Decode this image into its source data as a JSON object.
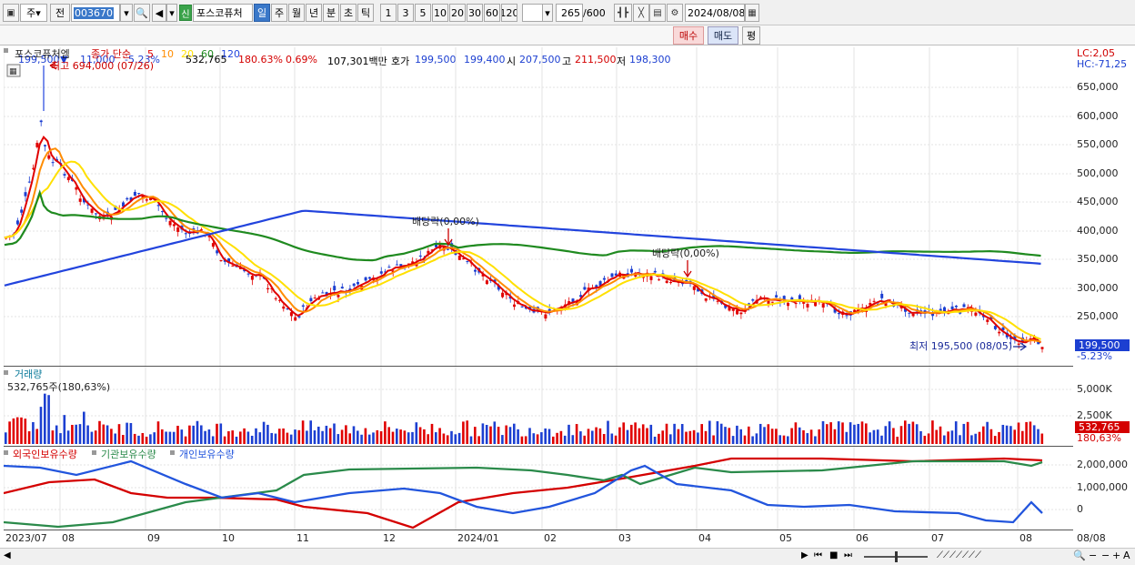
{
  "toolbar": {
    "market": "주",
    "prev": "전",
    "code": "003670",
    "name": "포스코퓨처",
    "new_badge": "신",
    "periods": [
      "일",
      "주",
      "월",
      "년",
      "분",
      "초",
      "틱"
    ],
    "intervals": [
      "1",
      "3",
      "5",
      "10",
      "20",
      "30",
      "60",
      "120"
    ],
    "count": "265",
    "count_total": "/600",
    "date": "2024/08/08"
  },
  "quote": {
    "price": "199,500",
    "arrow": "▼",
    "change": "11,000",
    "change_pct": "-5.23%",
    "volume": "532,765",
    "volume_ratio": "180.63%",
    "turnover": "0.69%",
    "amount": "107,301백만",
    "bid_label": "호가",
    "bid1": "199,500",
    "bid2": "199,400",
    "open_label": "시",
    "open": "207,500",
    "high_label": "고",
    "high": "211,500",
    "low_label": "저",
    "low": "198,300",
    "buy": "매수",
    "sell": "매도",
    "eval": "평"
  },
  "price_panel": {
    "legend_name": "포스코퓨처엠",
    "legend_type": "종가 단순",
    "ma_periods": [
      "5",
      "10",
      "20",
      "60",
      "120"
    ],
    "ma_colors": [
      "#e00000",
      "#ff8c00",
      "#ffe000",
      "#1f8a1f",
      "#2244dd"
    ],
    "high_annot": "최고 694,000 (07/26)",
    "low_annot": "최저 195,500 (08/05)",
    "dividend1": "배당락(0,00%)",
    "dividend2": "배당락(0,00%)",
    "lc": "LC:2,05",
    "hc": "HC:-71,25",
    "last_price": "199,500",
    "last_pct": "-5.23%",
    "y_ticks": [
      "650,000",
      "600,000",
      "550,000",
      "500,000",
      "450,000",
      "400,000",
      "350,000",
      "300,000",
      "250,000"
    ]
  },
  "volume_panel": {
    "title": "거래량",
    "info": "532,765주(180,63%)",
    "y_ticks": [
      "5,000K",
      "2,500K"
    ],
    "last": "532,765",
    "last_pct": "180,63%"
  },
  "holdings_panel": {
    "legend": [
      "외국인보유수량",
      "기관보유수량",
      "개인보유수량"
    ],
    "colors": [
      "#d40000",
      "#2a8a4a",
      "#2255dd"
    ],
    "y_ticks": [
      "2,000,000",
      "1,000,000",
      "0"
    ]
  },
  "x_axis": {
    "labels": [
      "2023/07",
      "08",
      "09",
      "10",
      "11",
      "12",
      "2024/01",
      "02",
      "03",
      "04",
      "05",
      "06",
      "07",
      "08"
    ],
    "right_label": "08/08"
  }
}
